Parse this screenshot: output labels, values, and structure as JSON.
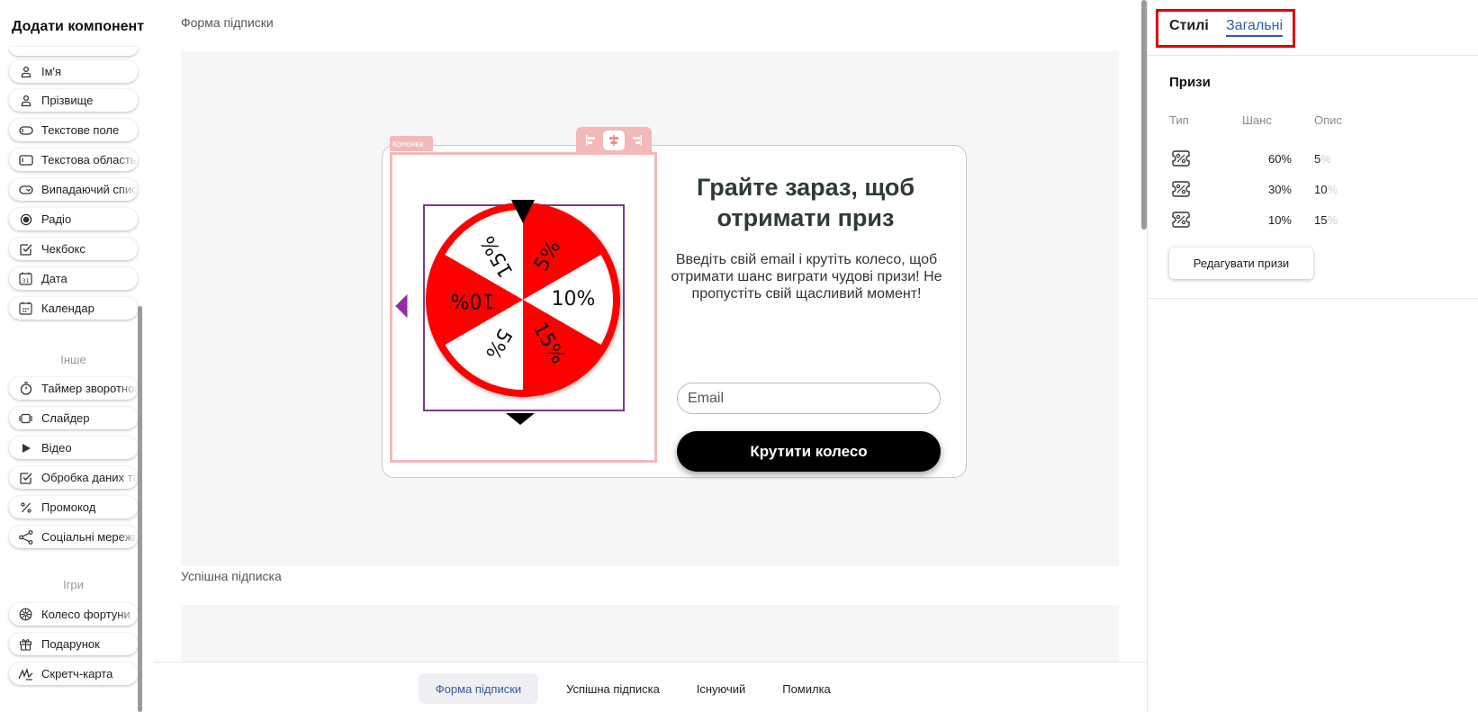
{
  "sidebar": {
    "title": "Додати компонент",
    "items": [
      {
        "label": "Ім'я",
        "icon": "person-icon"
      },
      {
        "label": "Прізвище",
        "icon": "person-icon"
      },
      {
        "label": "Текстове поле",
        "icon": "text-field-icon"
      },
      {
        "label": "Текстова область",
        "icon": "text-area-icon"
      },
      {
        "label": "Випадаючий список",
        "icon": "dropdown-icon"
      },
      {
        "label": "Радіо",
        "icon": "radio-icon"
      },
      {
        "label": "Чекбокс",
        "icon": "checkbox-icon"
      },
      {
        "label": "Дата",
        "icon": "date-icon"
      },
      {
        "label": "Календар",
        "icon": "calendar-icon"
      }
    ],
    "other_label": "Інше",
    "other_items": [
      {
        "label": "Таймер зворотного відліку",
        "icon": "timer-icon"
      },
      {
        "label": "Слайдер",
        "icon": "slider-icon"
      },
      {
        "label": "Відео",
        "icon": "play-icon"
      },
      {
        "label": "Обробка даних та згода",
        "icon": "checkbox-icon"
      },
      {
        "label": "Промокод",
        "icon": "percent-icon"
      },
      {
        "label": "Соціальні мережі",
        "icon": "share-icon"
      }
    ],
    "games_label": "Ігри",
    "game_items": [
      {
        "label": "Колесо фортуни",
        "icon": "wheel-icon"
      },
      {
        "label": "Подарунок",
        "icon": "gift-icon"
      },
      {
        "label": "Скретч-карта",
        "icon": "scratch-icon"
      }
    ]
  },
  "canvas": {
    "section1_label": "Форма підписки",
    "section2_label": "Успішна підписка",
    "column_tag": "Колонка",
    "popup": {
      "title": "Грайте зараз, щоб отримати приз",
      "description": "Введіть свій email і крутіть колесо, щоб отримати шанс виграти чудові призи! Не пропустіть свій щасливий момент!",
      "email_placeholder": "Email",
      "button_label": "Крутити колесо"
    },
    "wheel_segments": [
      "5%",
      "10%",
      "15%",
      "5%",
      "10%",
      "15%"
    ],
    "colors": {
      "wheel_red": "#ff0000",
      "wheel_white": "#ffffff",
      "selection": "#7a3a8c",
      "column_frame": "#f3b8b8"
    }
  },
  "bottom_tabs": [
    "Форма підписки",
    "Успішна підписка",
    "Існуючий",
    "Помилка"
  ],
  "rpanel": {
    "tab_styles": "Стилі",
    "tab_general": "Загальні",
    "section_title": "Призи",
    "col_type": "Тип",
    "col_chance": "Шанс",
    "col_desc": "Опис",
    "prizes": [
      {
        "chance": "60%",
        "desc": "5",
        "unit": "%"
      },
      {
        "chance": "30%",
        "desc": "10",
        "unit": "%"
      },
      {
        "chance": "10%",
        "desc": "15",
        "unit": "%"
      }
    ],
    "edit_button": "Редагувати призи"
  }
}
